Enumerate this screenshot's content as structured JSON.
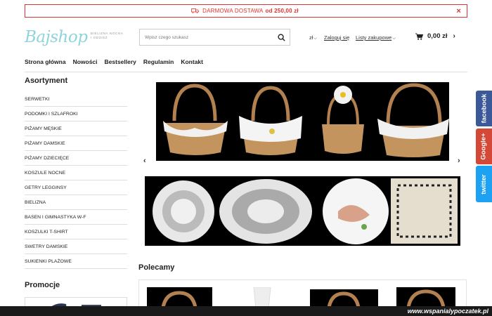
{
  "promo_bar": {
    "text_before": "DARMOWA DOSTAWA",
    "text_bold": "od 250,00 zł",
    "close": "×"
  },
  "header": {
    "logo": "Bajshop",
    "tagline": [
      "BIELIZNA NOCNA",
      "I ODZIEŻ"
    ],
    "search_placeholder": "Wpisz czego szukasz",
    "currency": "zł",
    "login": "Zaloguj się",
    "lists": "Listy zakupowe",
    "cart_amount": "0,00 zł"
  },
  "nav": [
    "Strona główna",
    "Nowości",
    "Bestsellery",
    "Regulamin",
    "Kontakt"
  ],
  "sidebar": {
    "title": "Asortyment",
    "categories": [
      "SERWETKI",
      "PODOMKI I SZLAFROKI",
      "PIŻAMY MĘSKIE",
      "PIŻAMY DAMSKIE",
      "PIŻAMY DZIECIĘCE",
      "KOSZULE NOCNE",
      "GETRY LEGGINSY",
      "BIELIZNA",
      "BASEN I GIMNASTYKA W-F",
      "KOSZULKI T-SHIRT",
      "SWETRY DAMSKIE",
      "SUKIENKI PLAŻOWE"
    ],
    "promo_title": "Promocje"
  },
  "recommended_title": "Polecamy",
  "social": [
    "facebook",
    "Google+",
    "twitter"
  ],
  "watermark": "www.wspanialypoczatek.pl",
  "colors": {
    "accent_red": "#dd3333",
    "logo": "#8fd4dc",
    "facebook": "#3b5998",
    "google": "#d34836",
    "twitter": "#1da1f2"
  }
}
